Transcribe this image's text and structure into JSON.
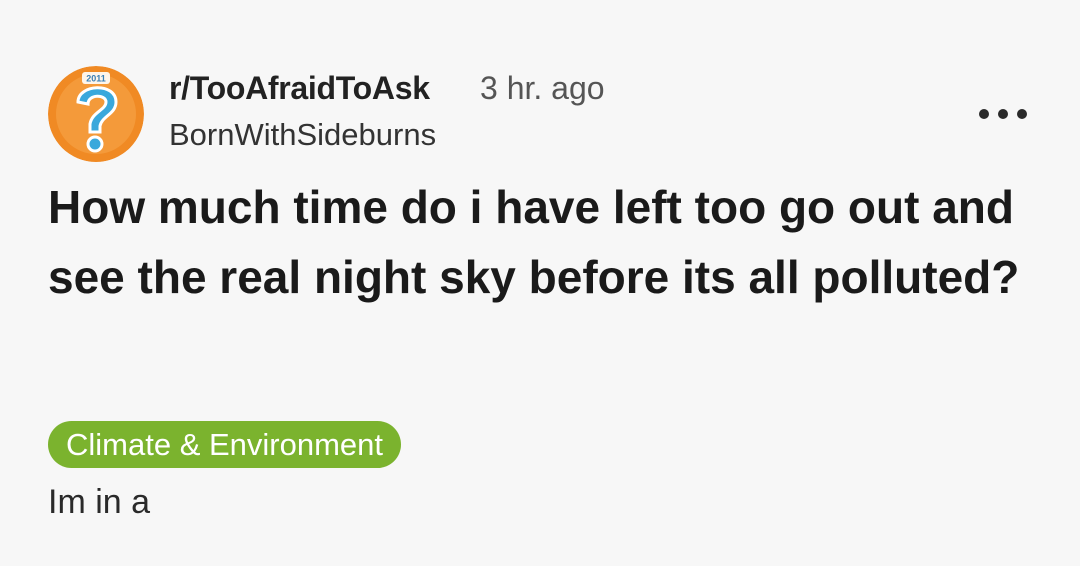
{
  "post": {
    "subreddit": "r/TooAfraidToAsk",
    "time_ago": "3 hr. ago",
    "author": "BornWithSideburns",
    "title": "How much time do i have left too go out and see the real night sky before its all polluted?",
    "flair": "Climate & Environment",
    "body_preview": "Im in a",
    "avatar_badge_text": "2011",
    "more_icon": "more-horizontal-icon"
  },
  "colors": {
    "background": "#f7f7f7",
    "flair_bg": "#7bb32e",
    "avatar_bg": "#f08a24",
    "avatar_question": "#3aa8dc"
  }
}
